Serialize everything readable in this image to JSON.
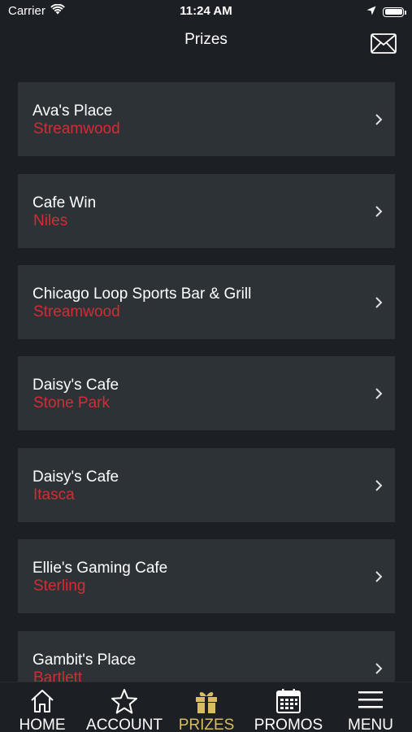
{
  "status_bar": {
    "carrier": "Carrier",
    "time": "11:24 AM",
    "icons": [
      "wifi-icon",
      "location-arrow-icon",
      "battery-icon"
    ]
  },
  "nav": {
    "title": "Prizes",
    "action_icon": "mail-icon"
  },
  "locations": [
    {
      "name": "Ava's Place",
      "city": "Streamwood"
    },
    {
      "name": "Cafe Win",
      "city": "Niles"
    },
    {
      "name": "Chicago Loop Sports Bar & Grill",
      "city": "Streamwood"
    },
    {
      "name": "Daisy's Cafe",
      "city": "Stone Park"
    },
    {
      "name": "Daisy's Cafe",
      "city": "Itasca"
    },
    {
      "name": "Ellie's Gaming Cafe",
      "city": "Sterling"
    },
    {
      "name": "Gambit's Place",
      "city": "Bartlett"
    }
  ],
  "tabs": [
    {
      "label": "HOME",
      "icon": "home-icon",
      "active": false
    },
    {
      "label": "ACCOUNT",
      "icon": "star-icon",
      "active": false
    },
    {
      "label": "PRIZES",
      "icon": "gift-icon",
      "active": true
    },
    {
      "label": "PROMOS",
      "icon": "calendar-icon",
      "active": false
    },
    {
      "label": "MENU",
      "icon": "hamburger-menu-icon",
      "active": false
    }
  ],
  "colors": {
    "background": "#1c1f23",
    "card": "#2d3237",
    "city_text": "#d42c34",
    "active_tab": "#d8bd62"
  }
}
